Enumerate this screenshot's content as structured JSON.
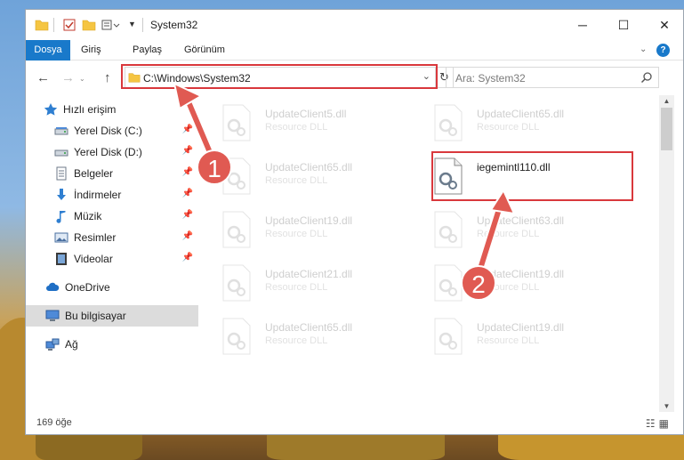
{
  "window": {
    "title": "System32",
    "controls": {
      "minimize": "─",
      "maximize": "☐",
      "close": "✕"
    }
  },
  "ribbon": {
    "tabs": [
      "Dosya",
      "Giriş",
      "Paylaş",
      "Görünüm"
    ],
    "help": "?"
  },
  "nav": {
    "back": "←",
    "forward": "→",
    "up": "↑",
    "address": "C:\\Windows\\System32",
    "refresh": "↻",
    "search_placeholder": "Ara: System32"
  },
  "sidebar": {
    "items": [
      {
        "label": "Hızlı erişim",
        "icon": "star-icon"
      },
      {
        "label": "Yerel Disk (C:)",
        "icon": "drive-icon"
      },
      {
        "label": "Yerel Disk (D:)",
        "icon": "drive-icon"
      },
      {
        "label": "Belgeler",
        "icon": "documents-icon"
      },
      {
        "label": "İndirmeler",
        "icon": "download-icon"
      },
      {
        "label": "Müzik",
        "icon": "music-icon"
      },
      {
        "label": "Resimler",
        "icon": "pictures-icon"
      },
      {
        "label": "Videolar",
        "icon": "video-icon"
      },
      {
        "label": "OneDrive",
        "icon": "cloud-icon"
      },
      {
        "label": "Bu bilgisayar",
        "icon": "computer-icon"
      },
      {
        "label": "Ağ",
        "icon": "network-icon"
      }
    ]
  },
  "files": {
    "left": [
      {
        "name": "UpdateClient5.dll",
        "type": "Resource DLL"
      },
      {
        "name": "UpdateClient65.dll",
        "type": "Resource DLL"
      },
      {
        "name": "UpdateClient19.dll",
        "type": "Resource DLL"
      },
      {
        "name": "UpdateClient21.dll",
        "type": "Resource DLL"
      },
      {
        "name": "UpdateClient65.dll",
        "type": "Resource DLL"
      }
    ],
    "right": [
      {
        "name": "UpdateClient65.dll",
        "type": "Resource DLL"
      },
      {
        "name": "iegemintl110.dll",
        "type": ""
      },
      {
        "name": "UpdateClient63.dll",
        "type": "Resource DLL"
      },
      {
        "name": "UpdateClient19.dll",
        "type": "Resource DLL"
      },
      {
        "name": "UpdateClient19.dll",
        "type": "Resource DLL"
      }
    ]
  },
  "status": {
    "count": "169 öğe"
  },
  "annotations": {
    "step1": "1",
    "step2": "2"
  },
  "colors": {
    "accent": "#1979ca",
    "highlight": "#d9383c",
    "badge": "#e05a52"
  }
}
